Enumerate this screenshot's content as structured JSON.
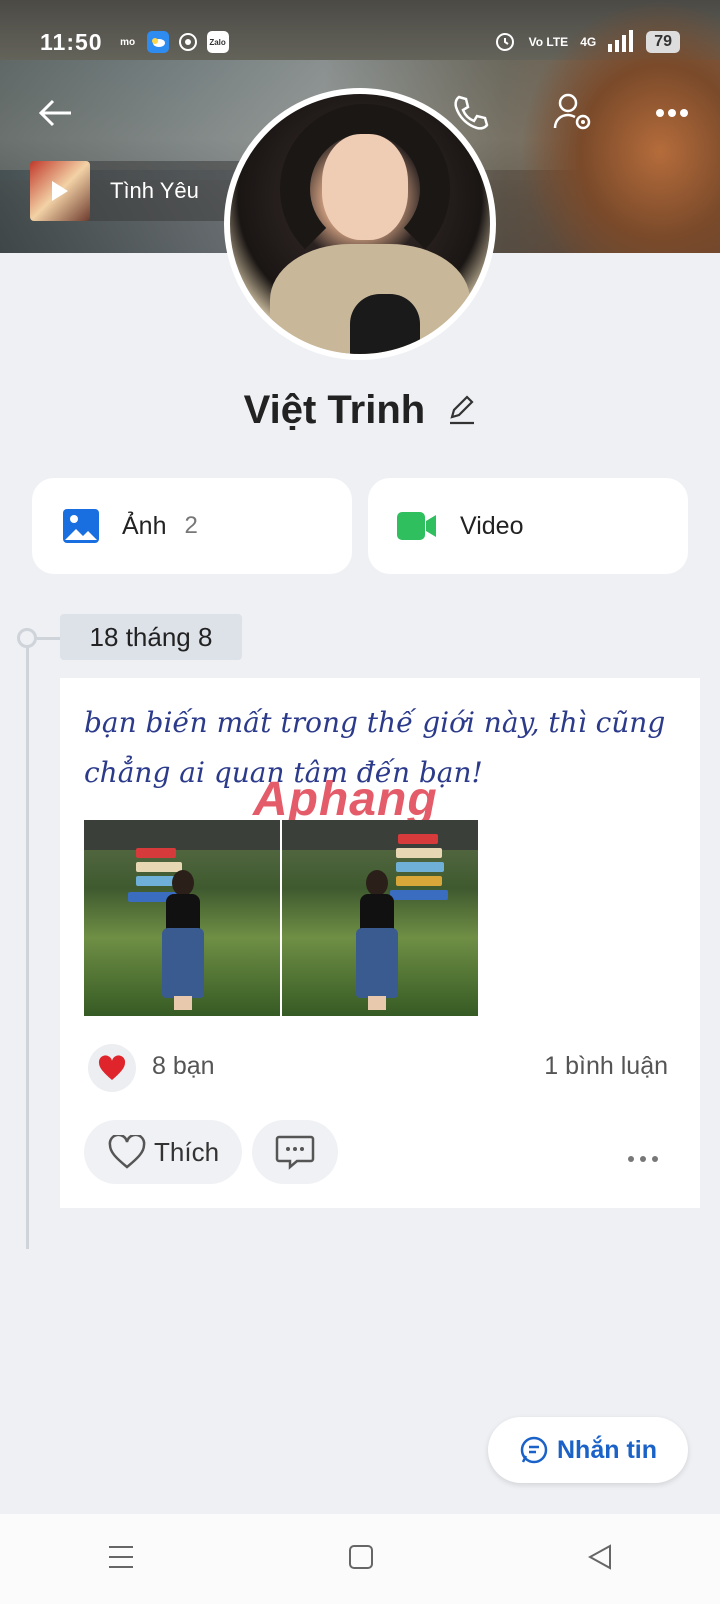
{
  "status_bar": {
    "time": "11:50",
    "app_icons": [
      "mo",
      "weather",
      "chrome",
      "Zalo"
    ],
    "network": "Vo LTE",
    "signal": "4G",
    "battery": "79"
  },
  "header": {
    "music": {
      "title": "Tình Yêu"
    }
  },
  "profile": {
    "name": "Việt Trinh"
  },
  "media": {
    "photos": {
      "label": "Ảnh",
      "count": "2"
    },
    "videos": {
      "label": "Video"
    }
  },
  "feed": {
    "date": "18 tháng 8",
    "post": {
      "text": "bạn biến mất trong thế giới này, thì cũng chẳng ai quan tâm đến bạn!",
      "watermark": "Aphang",
      "reaction_count": "8 bạn",
      "comment_count": "1 bình luận",
      "like_label": "Thích"
    }
  },
  "fab": {
    "label": "Nhắn tin"
  },
  "colors": {
    "accent": "#1a62c8",
    "video_icon": "#2fbf5f",
    "photo_icon": "#1a6fe0",
    "heart": "#e0242c"
  }
}
